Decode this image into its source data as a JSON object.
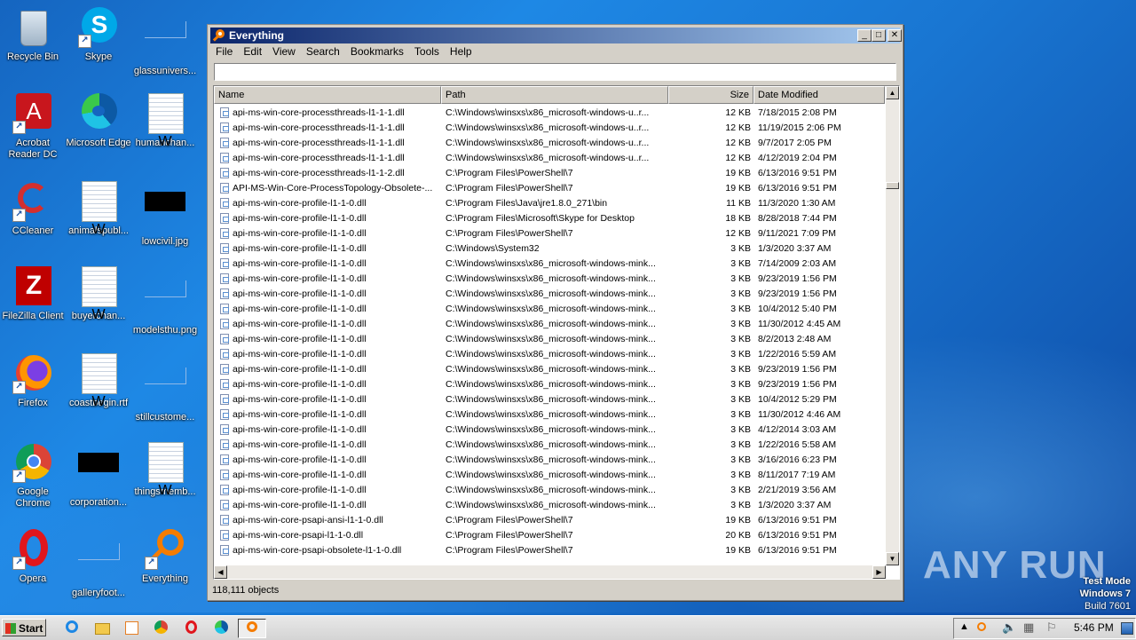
{
  "desktop": {
    "icons": [
      {
        "label": "Recycle Bin"
      },
      {
        "label": "Skype"
      },
      {
        "label": "glassunivers..."
      },
      {
        "label": "Acrobat Reader DC"
      },
      {
        "label": "Microsoft Edge"
      },
      {
        "label": "humanchan..."
      },
      {
        "label": "CCleaner"
      },
      {
        "label": "animalspubl..."
      },
      {
        "label": "lowcivil.jpg"
      },
      {
        "label": "FileZilla Client"
      },
      {
        "label": "buyerchan..."
      },
      {
        "label": "modelsthu.png"
      },
      {
        "label": "Firefox"
      },
      {
        "label": "coastbegin.rtf"
      },
      {
        "label": "stillcustome..."
      },
      {
        "label": "Google Chrome"
      },
      {
        "label": "corporation..."
      },
      {
        "label": "thingsmemb..."
      },
      {
        "label": "Opera"
      },
      {
        "label": "galleryfoot..."
      },
      {
        "label": "Everything"
      }
    ]
  },
  "window": {
    "title": "Everything",
    "menu": [
      "File",
      "Edit",
      "View",
      "Search",
      "Bookmarks",
      "Tools",
      "Help"
    ],
    "search": {
      "value": "",
      "placeholder": ""
    },
    "columns": [
      "Name",
      "Path",
      "Size",
      "Date Modified"
    ],
    "rows": [
      [
        "api-ms-win-core-processthreads-l1-1-1.dll",
        "C:\\Windows\\winsxs\\x86_microsoft-windows-u..r...",
        "12 KB",
        "7/18/2015 2:08 PM"
      ],
      [
        "api-ms-win-core-processthreads-l1-1-1.dll",
        "C:\\Windows\\winsxs\\x86_microsoft-windows-u..r...",
        "12 KB",
        "11/19/2015 2:06 PM"
      ],
      [
        "api-ms-win-core-processthreads-l1-1-1.dll",
        "C:\\Windows\\winsxs\\x86_microsoft-windows-u..r...",
        "12 KB",
        "9/7/2017 2:05 PM"
      ],
      [
        "api-ms-win-core-processthreads-l1-1-1.dll",
        "C:\\Windows\\winsxs\\x86_microsoft-windows-u..r...",
        "12 KB",
        "4/12/2019 2:04 PM"
      ],
      [
        "api-ms-win-core-processthreads-l1-1-2.dll",
        "C:\\Program Files\\PowerShell\\7",
        "19 KB",
        "6/13/2016 9:51 PM"
      ],
      [
        "API-MS-Win-Core-ProcessTopology-Obsolete-...",
        "C:\\Program Files\\PowerShell\\7",
        "19 KB",
        "6/13/2016 9:51 PM"
      ],
      [
        "api-ms-win-core-profile-l1-1-0.dll",
        "C:\\Program Files\\Java\\jre1.8.0_271\\bin",
        "11 KB",
        "11/3/2020 1:30 AM"
      ],
      [
        "api-ms-win-core-profile-l1-1-0.dll",
        "C:\\Program Files\\Microsoft\\Skype for Desktop",
        "18 KB",
        "8/28/2018 7:44 PM"
      ],
      [
        "api-ms-win-core-profile-l1-1-0.dll",
        "C:\\Program Files\\PowerShell\\7",
        "12 KB",
        "9/11/2021 7:09 PM"
      ],
      [
        "api-ms-win-core-profile-l1-1-0.dll",
        "C:\\Windows\\System32",
        "3 KB",
        "1/3/2020 3:37 AM"
      ],
      [
        "api-ms-win-core-profile-l1-1-0.dll",
        "C:\\Windows\\winsxs\\x86_microsoft-windows-mink...",
        "3 KB",
        "7/14/2009 2:03 AM"
      ],
      [
        "api-ms-win-core-profile-l1-1-0.dll",
        "C:\\Windows\\winsxs\\x86_microsoft-windows-mink...",
        "3 KB",
        "9/23/2019 1:56 PM"
      ],
      [
        "api-ms-win-core-profile-l1-1-0.dll",
        "C:\\Windows\\winsxs\\x86_microsoft-windows-mink...",
        "3 KB",
        "9/23/2019 1:56 PM"
      ],
      [
        "api-ms-win-core-profile-l1-1-0.dll",
        "C:\\Windows\\winsxs\\x86_microsoft-windows-mink...",
        "3 KB",
        "10/4/2012 5:40 PM"
      ],
      [
        "api-ms-win-core-profile-l1-1-0.dll",
        "C:\\Windows\\winsxs\\x86_microsoft-windows-mink...",
        "3 KB",
        "11/30/2012 4:45 AM"
      ],
      [
        "api-ms-win-core-profile-l1-1-0.dll",
        "C:\\Windows\\winsxs\\x86_microsoft-windows-mink...",
        "3 KB",
        "8/2/2013 2:48 AM"
      ],
      [
        "api-ms-win-core-profile-l1-1-0.dll",
        "C:\\Windows\\winsxs\\x86_microsoft-windows-mink...",
        "3 KB",
        "1/22/2016 5:59 AM"
      ],
      [
        "api-ms-win-core-profile-l1-1-0.dll",
        "C:\\Windows\\winsxs\\x86_microsoft-windows-mink...",
        "3 KB",
        "9/23/2019 1:56 PM"
      ],
      [
        "api-ms-win-core-profile-l1-1-0.dll",
        "C:\\Windows\\winsxs\\x86_microsoft-windows-mink...",
        "3 KB",
        "9/23/2019 1:56 PM"
      ],
      [
        "api-ms-win-core-profile-l1-1-0.dll",
        "C:\\Windows\\winsxs\\x86_microsoft-windows-mink...",
        "3 KB",
        "10/4/2012 5:29 PM"
      ],
      [
        "api-ms-win-core-profile-l1-1-0.dll",
        "C:\\Windows\\winsxs\\x86_microsoft-windows-mink...",
        "3 KB",
        "11/30/2012 4:46 AM"
      ],
      [
        "api-ms-win-core-profile-l1-1-0.dll",
        "C:\\Windows\\winsxs\\x86_microsoft-windows-mink...",
        "3 KB",
        "4/12/2014 3:03 AM"
      ],
      [
        "api-ms-win-core-profile-l1-1-0.dll",
        "C:\\Windows\\winsxs\\x86_microsoft-windows-mink...",
        "3 KB",
        "1/22/2016 5:58 AM"
      ],
      [
        "api-ms-win-core-profile-l1-1-0.dll",
        "C:\\Windows\\winsxs\\x86_microsoft-windows-mink...",
        "3 KB",
        "3/16/2016 6:23 PM"
      ],
      [
        "api-ms-win-core-profile-l1-1-0.dll",
        "C:\\Windows\\winsxs\\x86_microsoft-windows-mink...",
        "3 KB",
        "8/11/2017 7:19 AM"
      ],
      [
        "api-ms-win-core-profile-l1-1-0.dll",
        "C:\\Windows\\winsxs\\x86_microsoft-windows-mink...",
        "3 KB",
        "2/21/2019 3:56 AM"
      ],
      [
        "api-ms-win-core-profile-l1-1-0.dll",
        "C:\\Windows\\winsxs\\x86_microsoft-windows-mink...",
        "3 KB",
        "1/3/2020 3:37 AM"
      ],
      [
        "api-ms-win-core-psapi-ansi-l1-1-0.dll",
        "C:\\Program Files\\PowerShell\\7",
        "19 KB",
        "6/13/2016 9:51 PM"
      ],
      [
        "api-ms-win-core-psapi-l1-1-0.dll",
        "C:\\Program Files\\PowerShell\\7",
        "20 KB",
        "6/13/2016 9:51 PM"
      ],
      [
        "api-ms-win-core-psapi-obsolete-l1-1-0.dll",
        "C:\\Program Files\\PowerShell\\7",
        "19 KB",
        "6/13/2016 9:51 PM"
      ]
    ],
    "status": "118,111 objects"
  },
  "watermark": {
    "brand": "ANY RUN"
  },
  "testmode": {
    "line1": "Test Mode",
    "line2": "Windows 7",
    "line3": "Build 7601"
  },
  "taskbar": {
    "start_label": "Start",
    "clock": "5:46 PM"
  },
  "colors": {
    "accent": "#0a246a",
    "desktop": "#1976d2"
  }
}
